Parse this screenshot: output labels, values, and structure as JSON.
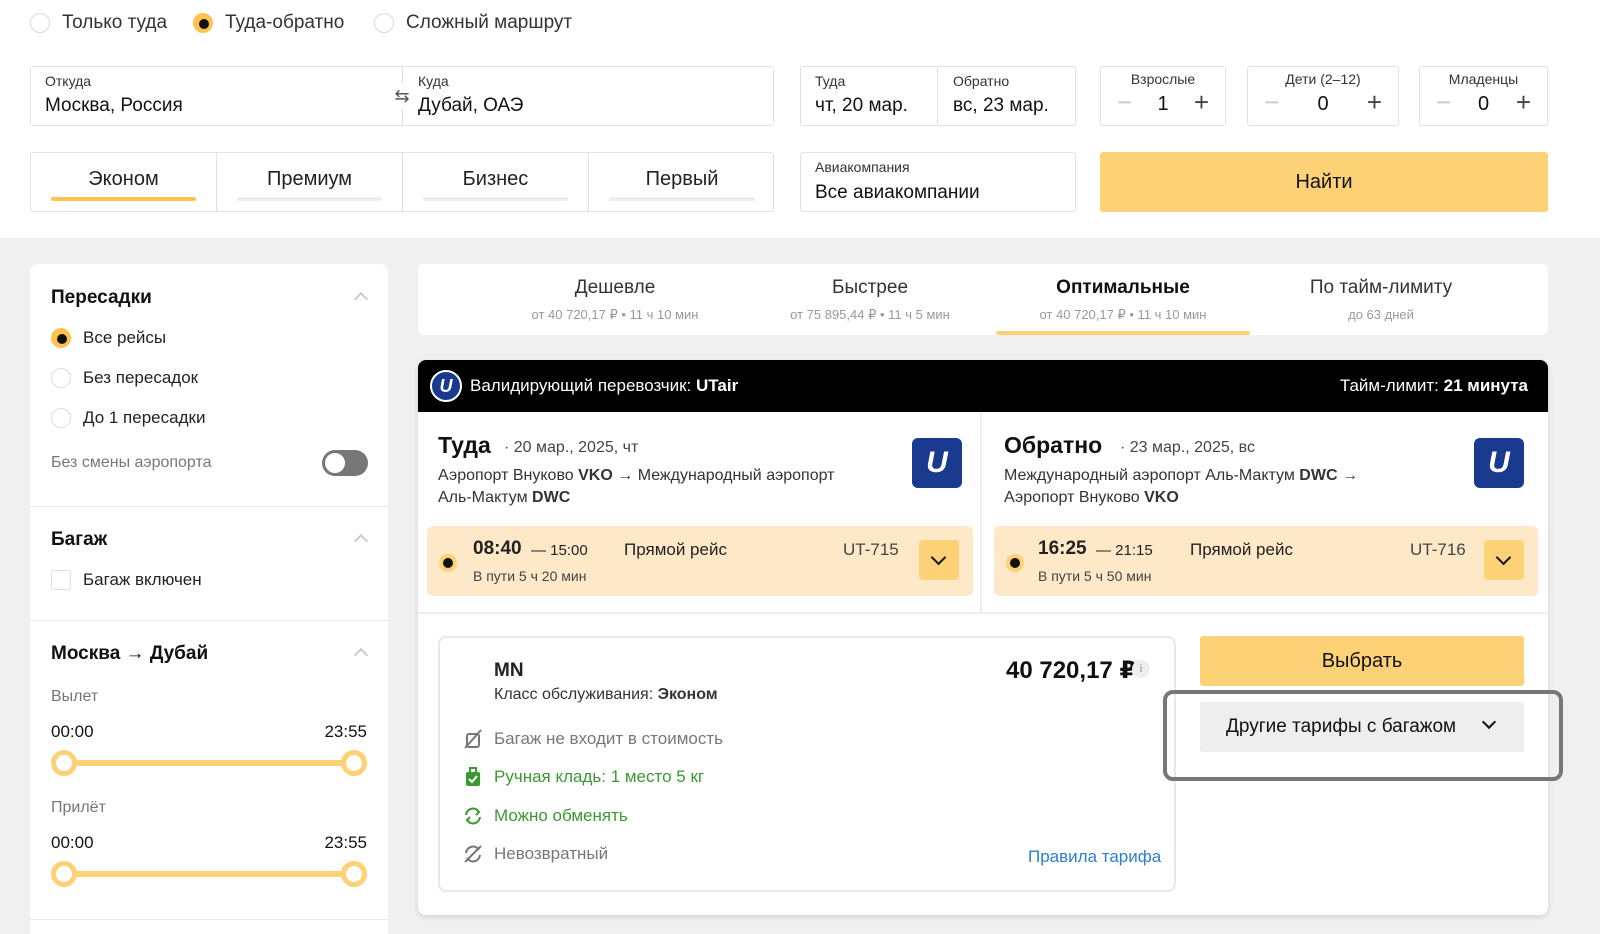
{
  "trip_types": [
    {
      "label": "Только туда",
      "selected": false
    },
    {
      "label": "Туда-обратно",
      "selected": true
    },
    {
      "label": "Сложный маршрут",
      "selected": false
    }
  ],
  "route": {
    "from_label": "Откуда",
    "from_value": "Москва, Россия",
    "to_label": "Куда",
    "to_value": "Дубай, ОАЭ"
  },
  "dates": {
    "there_label": "Туда",
    "there_value": "чт, 20 мар.",
    "back_label": "Обратно",
    "back_value": "вс, 23 мар."
  },
  "passengers": [
    {
      "label": "Взрослые",
      "value": "1"
    },
    {
      "label": "Дети (2–12)",
      "value": "0"
    },
    {
      "label": "Младенцы",
      "value": "0"
    }
  ],
  "pax_minus": "−",
  "pax_plus": "+",
  "cabin_classes": [
    "Эконом",
    "Премиум",
    "Бизнес",
    "Первый"
  ],
  "airline": {
    "label": "Авиакомпания",
    "value": "Все авиакомпании"
  },
  "search_button": "Найти",
  "filters": {
    "transfers_title": "Пересадки",
    "transfer_options": [
      "Все рейсы",
      "Без пересадок",
      "До 1 пересадки"
    ],
    "same_airport": "Без смены аэропорта",
    "baggage_title": "Багаж",
    "baggage_option": "Багаж включен",
    "route_title": "Москва → Дубай",
    "departure_label": "Вылет",
    "departure_from": "00:00",
    "departure_to": "23:55",
    "arrival_label": "Прилёт",
    "arrival_from": "00:00",
    "arrival_to": "23:55"
  },
  "sort_tabs": [
    {
      "title": "Дешевле",
      "sub": "от 40 720,17 ₽ • 11 ч 10 мин"
    },
    {
      "title": "Быстрее",
      "sub": "от 75 895,44 ₽ • 11 ч 5 мин"
    },
    {
      "title": "Оптимальные",
      "sub": "от 40 720,17 ₽ • 11 ч 10 мин"
    },
    {
      "title": "По тайм-лимиту",
      "sub": "до 63 дней"
    }
  ],
  "offer": {
    "carrier_prefix": "Валидирующий перевозчик:",
    "carrier": "UTair",
    "timelimit_prefix": "Тайм-лимит:",
    "timelimit": "21 минута",
    "logo_letter": "U",
    "outbound": {
      "title": "Туда",
      "date": "· 20 мар., 2025, чт",
      "route_1a": "Аэропорт Внуково ",
      "route_1b": "VKO",
      "route_1c": " → Международный аэропорт",
      "route_2a": "Аль-Мактум ",
      "route_2b": "DWC",
      "dep": "08:40",
      "arr": "— 15:00",
      "type": "Прямой рейс",
      "flight": "UT-715",
      "duration": "В пути 5 ч 20 мин"
    },
    "inbound": {
      "title": "Обратно",
      "date": "· 23 мар., 2025, вс",
      "route_1a": "Международный аэропорт Аль-Мактум ",
      "route_1b": "DWC",
      "route_1c": " →",
      "route_2a": "Аэропорт Внуково ",
      "route_2b": "VKO",
      "dep": "16:25",
      "arr": "— 21:15",
      "type": "Прямой рейс",
      "flight": "UT-716",
      "duration": "В пути 5 ч 50 мин"
    },
    "fare": {
      "code": "MN",
      "class_prefix": "Класс обслуживания:",
      "class_value": "Эконом",
      "price": "40 720,17 ₽",
      "info": "i",
      "features": [
        {
          "text": "Багаж не входит в стоимость",
          "color": "#777777"
        },
        {
          "text": "Ручная кладь: 1 место 5 кг",
          "color": "#3a9a2f"
        },
        {
          "text": "Можно обменять",
          "color": "#3a9a2f"
        },
        {
          "text": "Невозвратный",
          "color": "#777777"
        }
      ],
      "rules_link": "Правила тарифа"
    },
    "select_button": "Выбрать",
    "other_fares_button": "Другие тарифы с багажом"
  },
  "colors": {
    "accent": "#fdd175",
    "green": "#3a9a2f",
    "link": "#2a7fd4",
    "utair": "#1a3a8f"
  }
}
